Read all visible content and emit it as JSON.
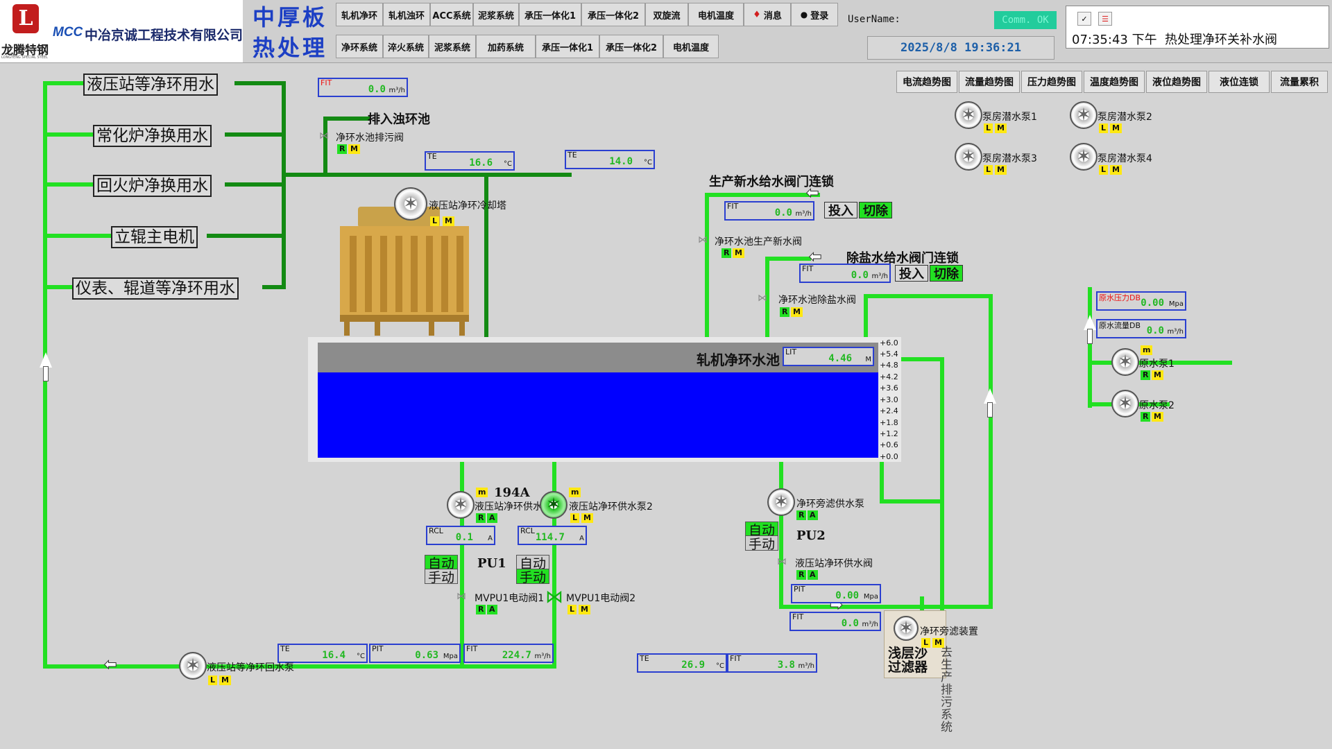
{
  "header": {
    "logo_name": "龙腾特钢",
    "logo_sub": "LONGTENG SPECIAL STEEL",
    "mcc_mark": "MCC",
    "mcc_name": "中冶京诚工程技术有限公司",
    "title_top": "中厚板",
    "title_bottom": "热处理",
    "nav_row1": [
      "轧机净环",
      "轧机浊环",
      "ACC系统",
      "泥浆系统",
      "承压一体化1",
      "承压一体化2",
      "双旋流",
      "电机温度",
      "消息",
      "登录"
    ],
    "nav_row2": [
      "净环系统",
      "淬火系统",
      "泥浆系统",
      "加药系统",
      "承压一体化1",
      "承压一体化2",
      "电机温度"
    ],
    "username_label": "UserName:",
    "comm_status": "Comm. OK",
    "datetime": "2025/8/8 19:36:21",
    "alarm_time": "07:35:43 下午",
    "alarm_text": "热处理净环关补水阀"
  },
  "trend_buttons": [
    "电流趋势图",
    "流量趋势图",
    "压力趋势图",
    "温度趋势图",
    "液位趋势图",
    "液位连锁",
    "流量累积"
  ],
  "consumers": [
    "液压站等净环用水",
    "常化炉净换用水",
    "回火炉净换用水",
    "立辊主电机",
    "仪表、辊道等净环用水"
  ],
  "meters": {
    "fit_top": {
      "tag": "FIT",
      "value": "0.0",
      "unit": "m³/h"
    },
    "te_a": {
      "tag": "TE",
      "value": "16.6",
      "unit": "°C"
    },
    "te_b": {
      "tag": "TE",
      "value": "14.0",
      "unit": "°C"
    },
    "fit_new": {
      "tag": "FIT",
      "value": "0.0",
      "unit": "m³/h"
    },
    "fit_desalt": {
      "tag": "FIT",
      "value": "0.0",
      "unit": "m³/h"
    },
    "raw_pressure": {
      "tag": "原水压力DB",
      "value": "0.00",
      "unit": "Mpa"
    },
    "raw_flow": {
      "tag": "原水流量DB",
      "value": "0.0",
      "unit": "m³/h"
    },
    "lit": {
      "tag": "LIT",
      "value": "4.46",
      "unit": "M"
    },
    "rcl1": {
      "tag": "RCL",
      "value": "0.1",
      "unit": "A"
    },
    "rcl2": {
      "tag": "RCL",
      "value": "114.7",
      "unit": "A"
    },
    "pit_pu2": {
      "tag": "PIT",
      "value": "0.00",
      "unit": "Mpa"
    },
    "fit_pu2": {
      "tag": "FIT",
      "value": "0.0",
      "unit": "m³/h"
    },
    "te_bottom": {
      "tag": "TE",
      "value": "16.4",
      "unit": "°C"
    },
    "pit_bottom": {
      "tag": "PIT",
      "value": "0.63",
      "unit": "Mpa"
    },
    "fit_bottom": {
      "tag": "FIT",
      "value": "224.7",
      "unit": "m³/h"
    },
    "te_filter": {
      "tag": "TE",
      "value": "26.9",
      "unit": "°C"
    },
    "fit_filter": {
      "tag": "FIT",
      "value": "3.8",
      "unit": "m³/h"
    }
  },
  "labels": {
    "drain_to": "排入浊环池",
    "drain_valve": "净环水池排污阀",
    "cooling_fan": "液压站净环冷却塔",
    "new_water_interlock": "生产新水给水阀门连锁",
    "new_water_valve": "净环水池生产新水阀",
    "desalt_interlock": "除盐水给水阀门连锁",
    "desalt_valve": "净环水池除盐水阀",
    "input": "投入",
    "cut": "切除",
    "tank_title": "轧机净环水池",
    "pump_current": "194A",
    "pu1": "PU1",
    "pu2": "PU2",
    "auto": "自动",
    "manual": "手动",
    "pump_pu1a": "液压站净环供水泵1",
    "pump_pu1b": "液压站净环供水泵2",
    "mvpu1a": "MVPU1电动阀1",
    "mvpu1b": "MVPU1电动阀2",
    "pump_side": "净环旁滤供水泵",
    "valve_side": "液压站净环供水阀",
    "filter_device": "净环旁滤装置",
    "filter_name": "浅层沙过滤器",
    "sewage": "去生产排污系统",
    "return_pump": "液压站等净环回水泵",
    "raw_pump1": "原水泵1",
    "raw_pump2": "原水泵2",
    "sub_pump1": "泵房潜水泵1",
    "sub_pump2": "泵房潜水泵2",
    "sub_pump3": "泵房潜水泵3",
    "sub_pump4": "泵房潜水泵4"
  },
  "tank_scale": [
    "+6.0",
    "+5.4",
    "+4.8",
    "+4.2",
    "+3.6",
    "+3.0",
    "+2.4",
    "+1.8",
    "+1.2",
    "+0.6",
    "+0.0"
  ],
  "tank_level": 4.46,
  "tank_max": 6.0,
  "colors": {
    "pipe": "#22e022",
    "pipe_dark": "#138a13",
    "water": "#0000ff",
    "meter_border": "#2a3fd0",
    "value": "#22b822"
  }
}
